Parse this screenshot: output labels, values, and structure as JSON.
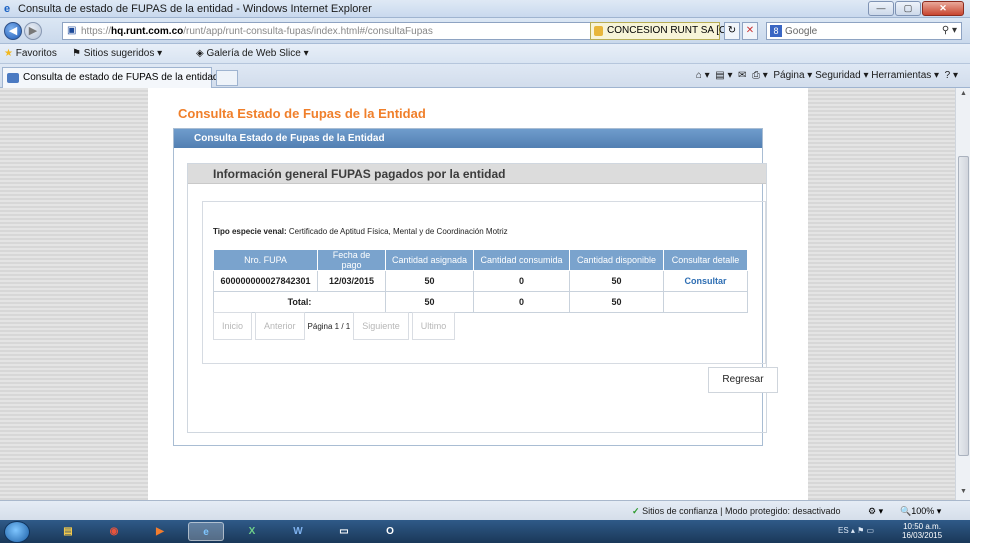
{
  "window": {
    "title": "Consulta de estado de FUPAS de la entidad - Windows Internet Explorer",
    "minimize": "—",
    "maximize": "▢",
    "close": "✕"
  },
  "address": {
    "url_prefix": "https://",
    "url_host": "hq.runt.com.co",
    "url_path": "/runt/app/runt-consulta-fupas/index.html#/consultaFupas",
    "certificate": "CONCESION RUNT SA [CO]",
    "search_engine": "Google"
  },
  "favorites": {
    "favorites_label": "Favoritos",
    "suggested_sites": "Sitios sugeridos ▾",
    "web_slice": "Galería de Web Slice ▾"
  },
  "tabs": {
    "active_tab": "Consulta de estado de FUPAS de la entidad",
    "command_bar": "Página ▾   Seguridad ▾   Herramientas ▾"
  },
  "page": {
    "title": "Consulta Estado de Fupas de la Entidad",
    "panel_title": "Consulta Estado de Fupas de la Entidad",
    "section_title": "Información general FUPAS pagados por la entidad",
    "tipo_label": "Tipo especie venal:",
    "tipo_value": "Certificado de Aptitud Física, Mental y de Coordinación Motriz",
    "table": {
      "headers": [
        "Nro. FUPA",
        "Fecha de pago",
        "Cantidad asignada",
        "Cantidad consumida",
        "Cantidad disponible",
        "Consultar detalle"
      ],
      "row": {
        "nro": "600000000027842301",
        "fecha": "12/03/2015",
        "asignada": "50",
        "consumida": "0",
        "disponible": "50",
        "detalle": "Consultar"
      },
      "total": {
        "label": "Total:",
        "asignada": "50",
        "consumida": "0",
        "disponible": "50"
      }
    },
    "pager": {
      "first": "Inicio",
      "prev": "Anterior",
      "info": "Página 1 / 1",
      "next": "Siguiente",
      "last": "Ultimo"
    },
    "back_button": "Regresar"
  },
  "status": {
    "text": "Sitios de confianza | Modo protegido: desactivado",
    "zoom": "100%"
  },
  "taskbar": {
    "lang": "ES",
    "time": "10:50 a.m.",
    "date": "16/03/2015"
  }
}
